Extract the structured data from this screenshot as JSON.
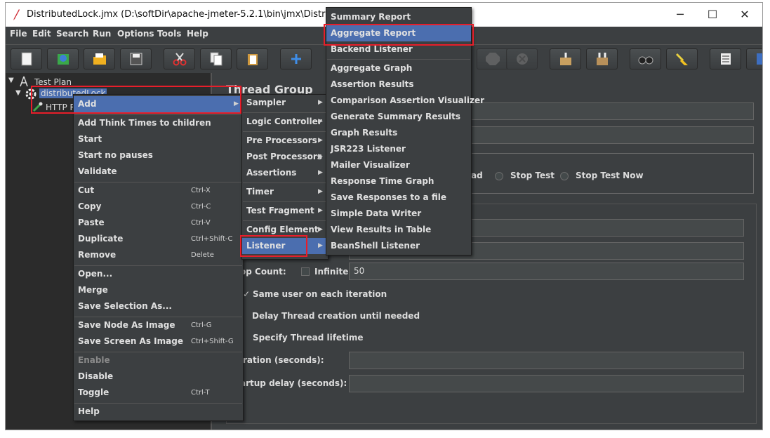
{
  "window": {
    "title": "DistributedLock.jmx (D:\\softDir\\apache-jmeter-5.2.1\\bin\\jmx\\DistributedLo",
    "minimize": "─",
    "maximize": "☐",
    "close": "✕"
  },
  "menubar": [
    "File",
    "Edit",
    "Search",
    "Run",
    "Options",
    "Tools",
    "Help"
  ],
  "tree": {
    "test_plan": "Test Plan",
    "thread_group": "distributedLock",
    "sampler": "HTTP R"
  },
  "panel": {
    "heading": "Thread Group",
    "radio_partial": "ad",
    "stop_test": "Stop Test",
    "stop_test_now": "Stop Test Now",
    "loop_count_label": "op Count:",
    "infinite_label": "Infinite",
    "loop_count_value": "50",
    "same_user": "Same user on each iteration",
    "delay_creation": "Delay Thread creation until needed",
    "specify_lifetime": "Specify Thread lifetime",
    "duration_label": "ration (seconds):",
    "startup_delay_label": "artup delay (seconds):"
  },
  "context_menu": {
    "add": "Add",
    "add_think_times": "Add Think Times to children",
    "start": "Start",
    "start_no_pauses": "Start no pauses",
    "validate": "Validate",
    "cut": {
      "label": "Cut",
      "key": "Ctrl-X"
    },
    "copy": {
      "label": "Copy",
      "key": "Ctrl-C"
    },
    "paste": {
      "label": "Paste",
      "key": "Ctrl-V"
    },
    "duplicate": {
      "label": "Duplicate",
      "key": "Ctrl+Shift-C"
    },
    "remove": {
      "label": "Remove",
      "key": "Delete"
    },
    "open": "Open...",
    "merge": "Merge",
    "save_selection": "Save Selection As...",
    "save_node_image": {
      "label": "Save Node As Image",
      "key": "Ctrl-G"
    },
    "save_screen_image": {
      "label": "Save Screen As Image",
      "key": "Ctrl+Shift-G"
    },
    "enable": "Enable",
    "disable": "Disable",
    "toggle": {
      "label": "Toggle",
      "key": "Ctrl-T"
    },
    "help": "Help"
  },
  "add_submenu": [
    "Sampler",
    "Logic Controller",
    "Pre Processors",
    "Post Processors",
    "Assertions",
    "Timer",
    "Test Fragment",
    "Config Element",
    "Listener"
  ],
  "listener_submenu": [
    "Summary Report",
    "Aggregate Report",
    "Backend Listener",
    "Aggregate Graph",
    "Assertion Results",
    "Comparison Assertion Visualizer",
    "Generate Summary Results",
    "Graph Results",
    "JSR223 Listener",
    "Mailer Visualizer",
    "Response Time Graph",
    "Save Responses to a file",
    "Simple Data Writer",
    "View Results in Table",
    "BeanShell Listener"
  ],
  "colors": {
    "selection": "#4b6eaf",
    "highlight_box": "#e81e2a",
    "background": "#3c3f41"
  }
}
